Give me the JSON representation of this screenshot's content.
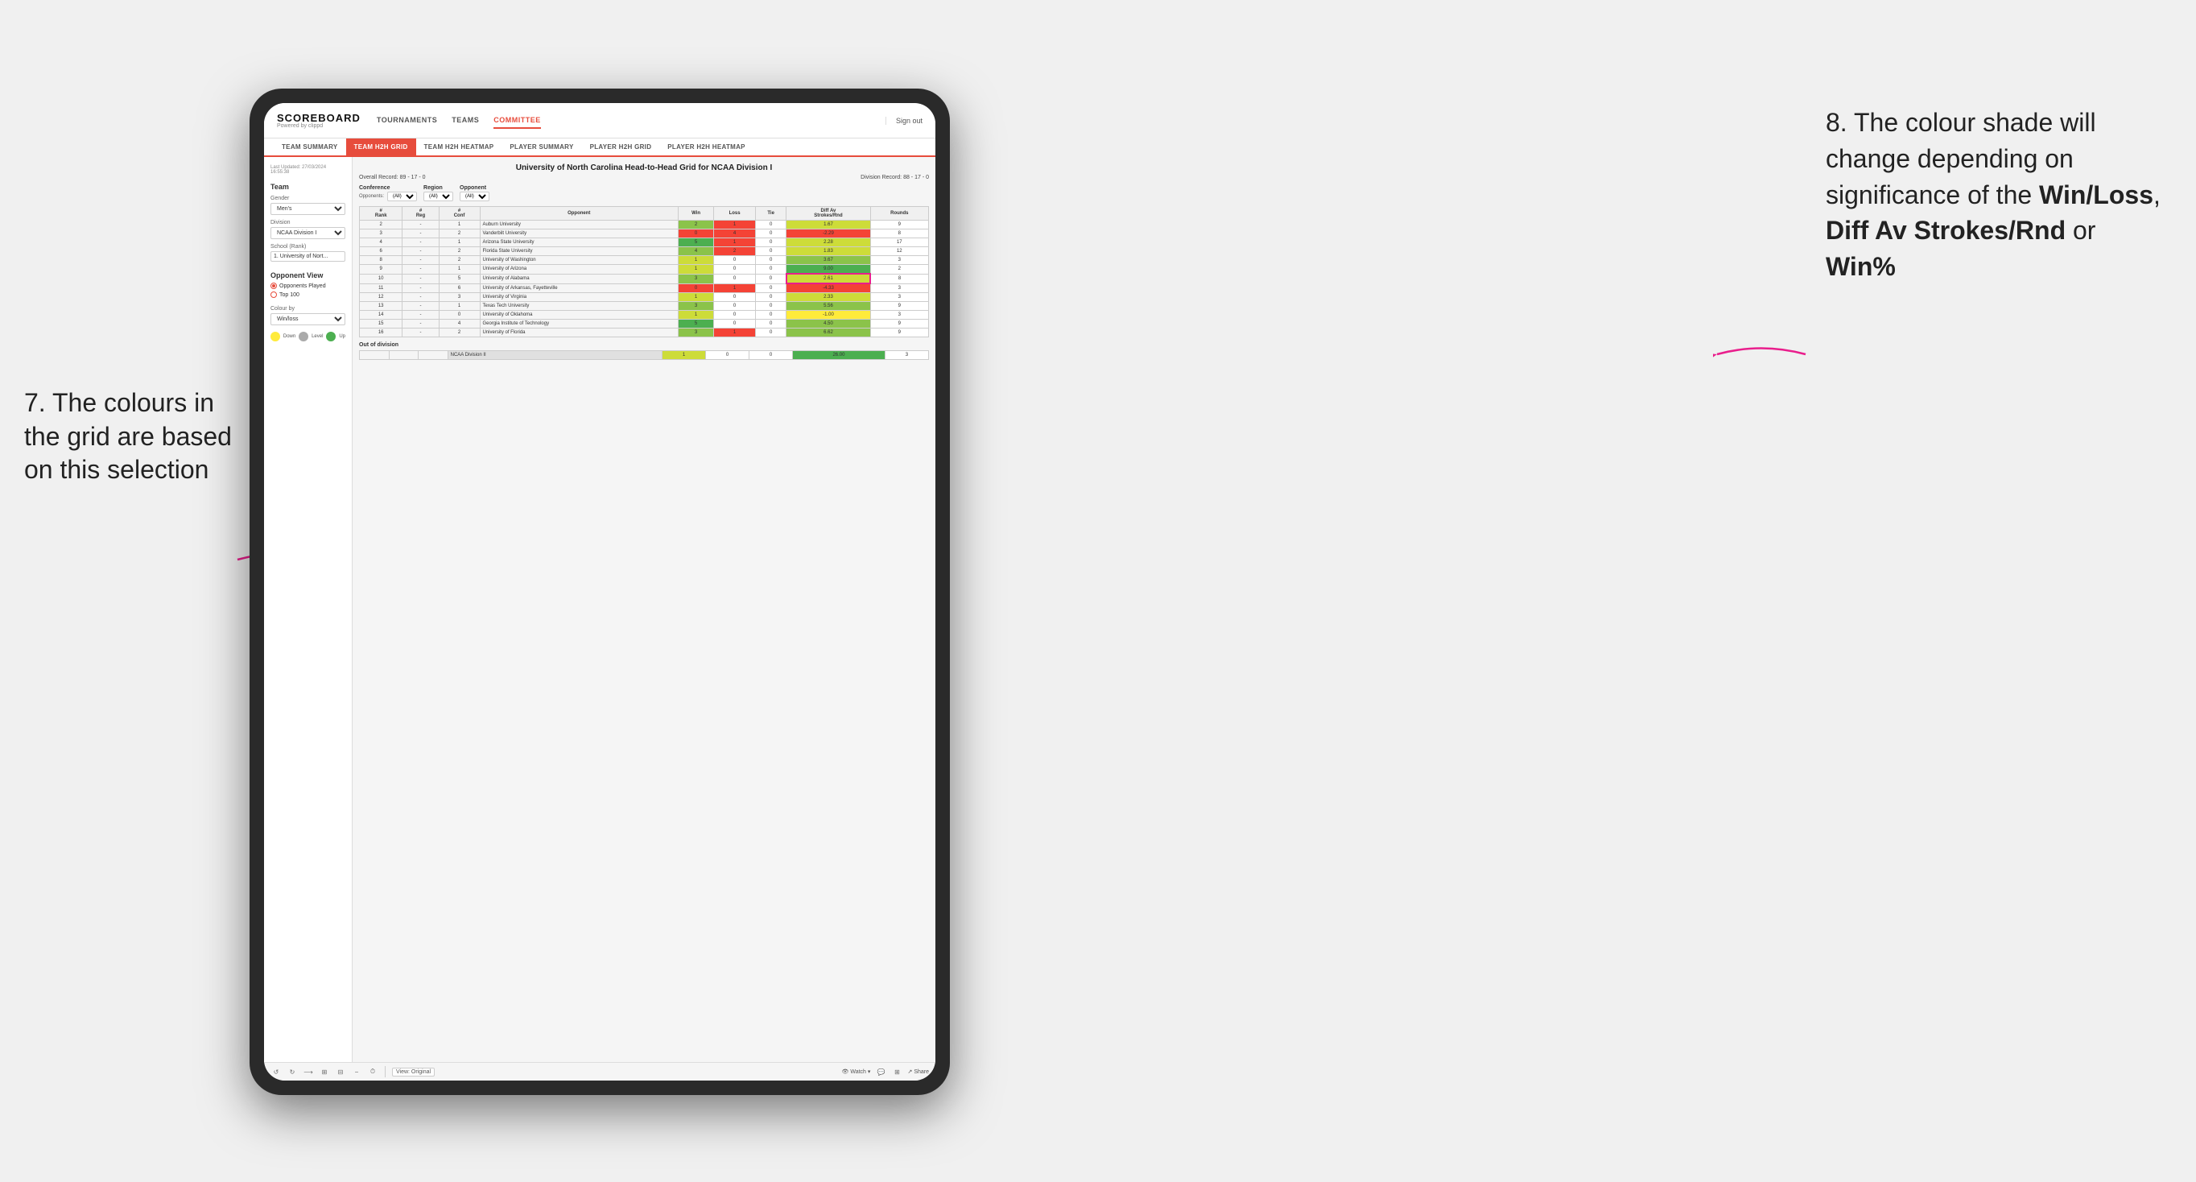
{
  "annotations": {
    "left_text": "7. The colours in the grid are based on this selection",
    "right_text_prefix": "8. The colour shade will change depending on significance of the ",
    "right_bold1": "Win/Loss",
    "right_sep1": ", ",
    "right_bold2": "Diff Av Strokes/Rnd",
    "right_sep2": " or ",
    "right_bold3": "Win%"
  },
  "header": {
    "logo": "SCOREBOARD",
    "logo_sub": "Powered by clippd",
    "nav": [
      "TOURNAMENTS",
      "TEAMS",
      "COMMITTEE"
    ],
    "sign_out": "Sign out"
  },
  "sub_nav": {
    "tabs": [
      "TEAM SUMMARY",
      "TEAM H2H GRID",
      "TEAM H2H HEATMAP",
      "PLAYER SUMMARY",
      "PLAYER H2H GRID",
      "PLAYER H2H HEATMAP"
    ],
    "active": "TEAM H2H GRID"
  },
  "sidebar": {
    "last_updated_label": "Last Updated: 27/03/2024",
    "last_updated_time": "16:55:38",
    "team_section": "Team",
    "gender_label": "Gender",
    "gender_value": "Men's",
    "division_label": "Division",
    "division_value": "NCAA Division I",
    "school_label": "School (Rank)",
    "school_value": "1. University of Nort...",
    "opponent_view_title": "Opponent View",
    "radio1": "Opponents Played",
    "radio2": "Top 100",
    "colour_by_label": "Colour by",
    "colour_by_value": "Win/loss",
    "legend_down": "Down",
    "legend_level": "Level",
    "legend_up": "Up"
  },
  "grid": {
    "title": "University of North Carolina Head-to-Head Grid for NCAA Division I",
    "overall_record_label": "Overall Record:",
    "overall_record": "89 - 17 - 0",
    "division_record_label": "Division Record:",
    "division_record": "88 - 17 - 0",
    "filters": {
      "opponents_label": "Opponents:",
      "conference_label": "Conference",
      "conference_value": "(All)",
      "region_label": "Region",
      "region_value": "(All)",
      "opponent_label": "Opponent",
      "opponent_value": "(All)"
    },
    "table_headers": [
      "#\nRank",
      "#\nReg",
      "#\nConf",
      "Opponent",
      "Win",
      "Loss",
      "Tie",
      "Diff Av\nStrokes/Rnd",
      "Rounds"
    ],
    "rows": [
      {
        "rank": "2",
        "reg": "-",
        "conf": "1",
        "opponent": "Auburn University",
        "win": "2",
        "loss": "1",
        "tie": "0",
        "diff": "1.67",
        "rounds": "9",
        "win_color": "green_mid",
        "diff_color": "green_light"
      },
      {
        "rank": "3",
        "reg": "-",
        "conf": "2",
        "opponent": "Vanderbilt University",
        "win": "0",
        "loss": "4",
        "tie": "0",
        "diff": "-2.29",
        "rounds": "8",
        "win_color": "red",
        "diff_color": "red"
      },
      {
        "rank": "4",
        "reg": "-",
        "conf": "1",
        "opponent": "Arizona State University",
        "win": "5",
        "loss": "1",
        "tie": "0",
        "diff": "2.28",
        "rounds": "17",
        "win_color": "green_dark",
        "diff_color": "green_light"
      },
      {
        "rank": "6",
        "reg": "-",
        "conf": "2",
        "opponent": "Florida State University",
        "win": "4",
        "loss": "2",
        "tie": "0",
        "diff": "1.83",
        "rounds": "12",
        "win_color": "green_mid",
        "diff_color": "green_light"
      },
      {
        "rank": "8",
        "reg": "-",
        "conf": "2",
        "opponent": "University of Washington",
        "win": "1",
        "loss": "0",
        "tie": "0",
        "diff": "3.67",
        "rounds": "3",
        "win_color": "green_light",
        "diff_color": "green_mid"
      },
      {
        "rank": "9",
        "reg": "-",
        "conf": "1",
        "opponent": "University of Arizona",
        "win": "1",
        "loss": "0",
        "tie": "0",
        "diff": "9.00",
        "rounds": "2",
        "win_color": "green_light",
        "diff_color": "green_dark"
      },
      {
        "rank": "10",
        "reg": "-",
        "conf": "5",
        "opponent": "University of Alabama",
        "win": "3",
        "loss": "0",
        "tie": "0",
        "diff": "2.61",
        "rounds": "8",
        "win_color": "green_mid",
        "diff_color": "green_light",
        "highlighted": true
      },
      {
        "rank": "11",
        "reg": "-",
        "conf": "6",
        "opponent": "University of Arkansas, Fayetteville",
        "win": "0",
        "loss": "1",
        "tie": "0",
        "diff": "-4.33",
        "rounds": "3",
        "win_color": "red",
        "diff_color": "red"
      },
      {
        "rank": "12",
        "reg": "-",
        "conf": "3",
        "opponent": "University of Virginia",
        "win": "1",
        "loss": "0",
        "tie": "0",
        "diff": "2.33",
        "rounds": "3",
        "win_color": "green_light",
        "diff_color": "green_light"
      },
      {
        "rank": "13",
        "reg": "-",
        "conf": "1",
        "opponent": "Texas Tech University",
        "win": "3",
        "loss": "0",
        "tie": "0",
        "diff": "5.56",
        "rounds": "9",
        "win_color": "green_mid",
        "diff_color": "green_mid"
      },
      {
        "rank": "14",
        "reg": "-",
        "conf": "0",
        "opponent": "University of Oklahoma",
        "win": "1",
        "loss": "0",
        "tie": "0",
        "diff": "-1.00",
        "rounds": "3",
        "win_color": "green_light",
        "diff_color": "yellow"
      },
      {
        "rank": "15",
        "reg": "-",
        "conf": "4",
        "opponent": "Georgia Institute of Technology",
        "win": "5",
        "loss": "0",
        "tie": "0",
        "diff": "4.50",
        "rounds": "9",
        "win_color": "green_dark",
        "diff_color": "green_mid"
      },
      {
        "rank": "16",
        "reg": "-",
        "conf": "2",
        "opponent": "University of Florida",
        "win": "3",
        "loss": "1",
        "tie": "0",
        "diff": "6.62",
        "rounds": "9",
        "win_color": "green_mid",
        "diff_color": "green_mid"
      }
    ],
    "out_of_division_label": "Out of division",
    "out_of_division_row": {
      "label": "NCAA Division II",
      "win": "1",
      "loss": "0",
      "tie": "0",
      "diff": "26.00",
      "rounds": "3",
      "diff_color": "green_dark"
    }
  },
  "toolbar": {
    "view_label": "View: Original",
    "watch_label": "Watch",
    "share_label": "Share"
  }
}
